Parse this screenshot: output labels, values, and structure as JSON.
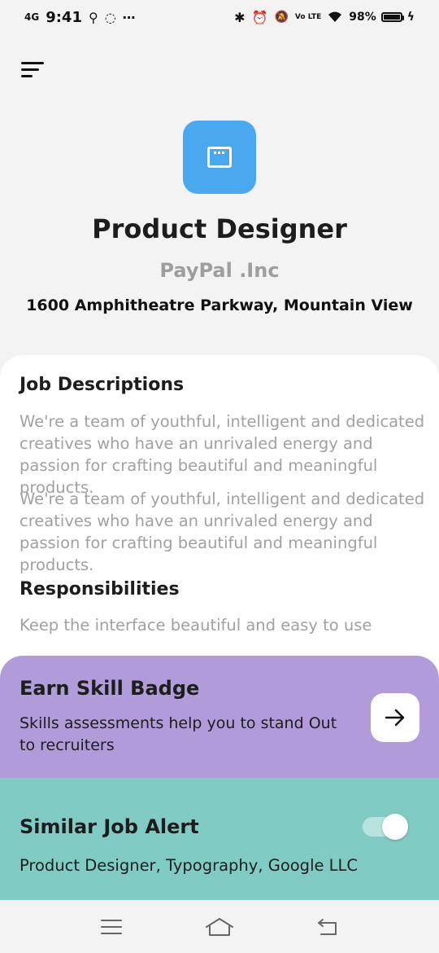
{
  "status_bar": {
    "network": "4G",
    "time": "9:41",
    "volte": "Vo LTE",
    "battery": "98%",
    "battery_level": 0.98
  },
  "job": {
    "title": "Product Designer",
    "company": "PayPal .Inc",
    "address": "1600 Amphitheatre Parkway, Mountain View"
  },
  "description": {
    "heading": "Job Descriptions",
    "paragraphs": [
      "We're a team of youthful, intelligent and dedicated creatives who have an unrivaled energy and passion for crafting beautiful and meaningful products.",
      "We're a team of youthful, intelligent and dedicated creatives who have an unrivaled energy and passion for crafting beautiful and meaningful products."
    ],
    "responsibilities_heading": "Responsibilities",
    "responsibilities_text": "Keep the interface beautiful and easy to use"
  },
  "skill_badge": {
    "title": "Earn Skill Badge",
    "text": "Skills assessments help you to stand Out to recruiters"
  },
  "job_alert": {
    "title": "Similar Job Alert",
    "text": "Product Designer, Typography, Google LLC",
    "enabled": true
  },
  "colors": {
    "logo": "#4aa8ef",
    "badge_card": "#b19cd9",
    "alert_card": "#80ccc4"
  }
}
